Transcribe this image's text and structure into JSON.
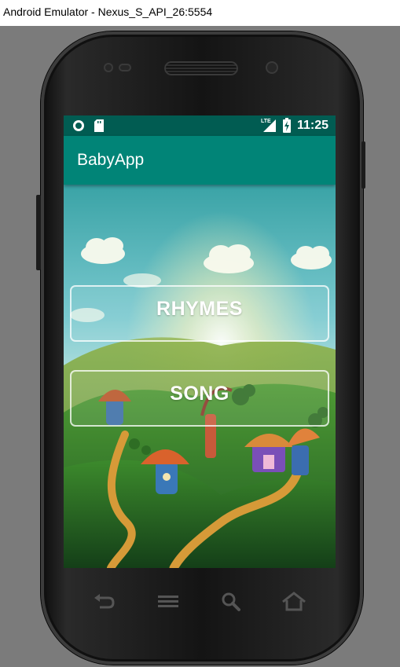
{
  "window": {
    "title": "Android Emulator - Nexus_S_API_26:5554"
  },
  "status_bar": {
    "network_label": "LTE",
    "time": "11:25"
  },
  "app_bar": {
    "title": "BabyApp"
  },
  "buttons": {
    "rhymes": "RHYMES",
    "song": "SONG"
  },
  "nav_keys": [
    "back-icon",
    "menu-icon",
    "search-icon",
    "home-icon"
  ],
  "colors": {
    "status_bar": "#015c52",
    "app_bar": "#018477",
    "emulator_bg": "#7b7b7b"
  }
}
